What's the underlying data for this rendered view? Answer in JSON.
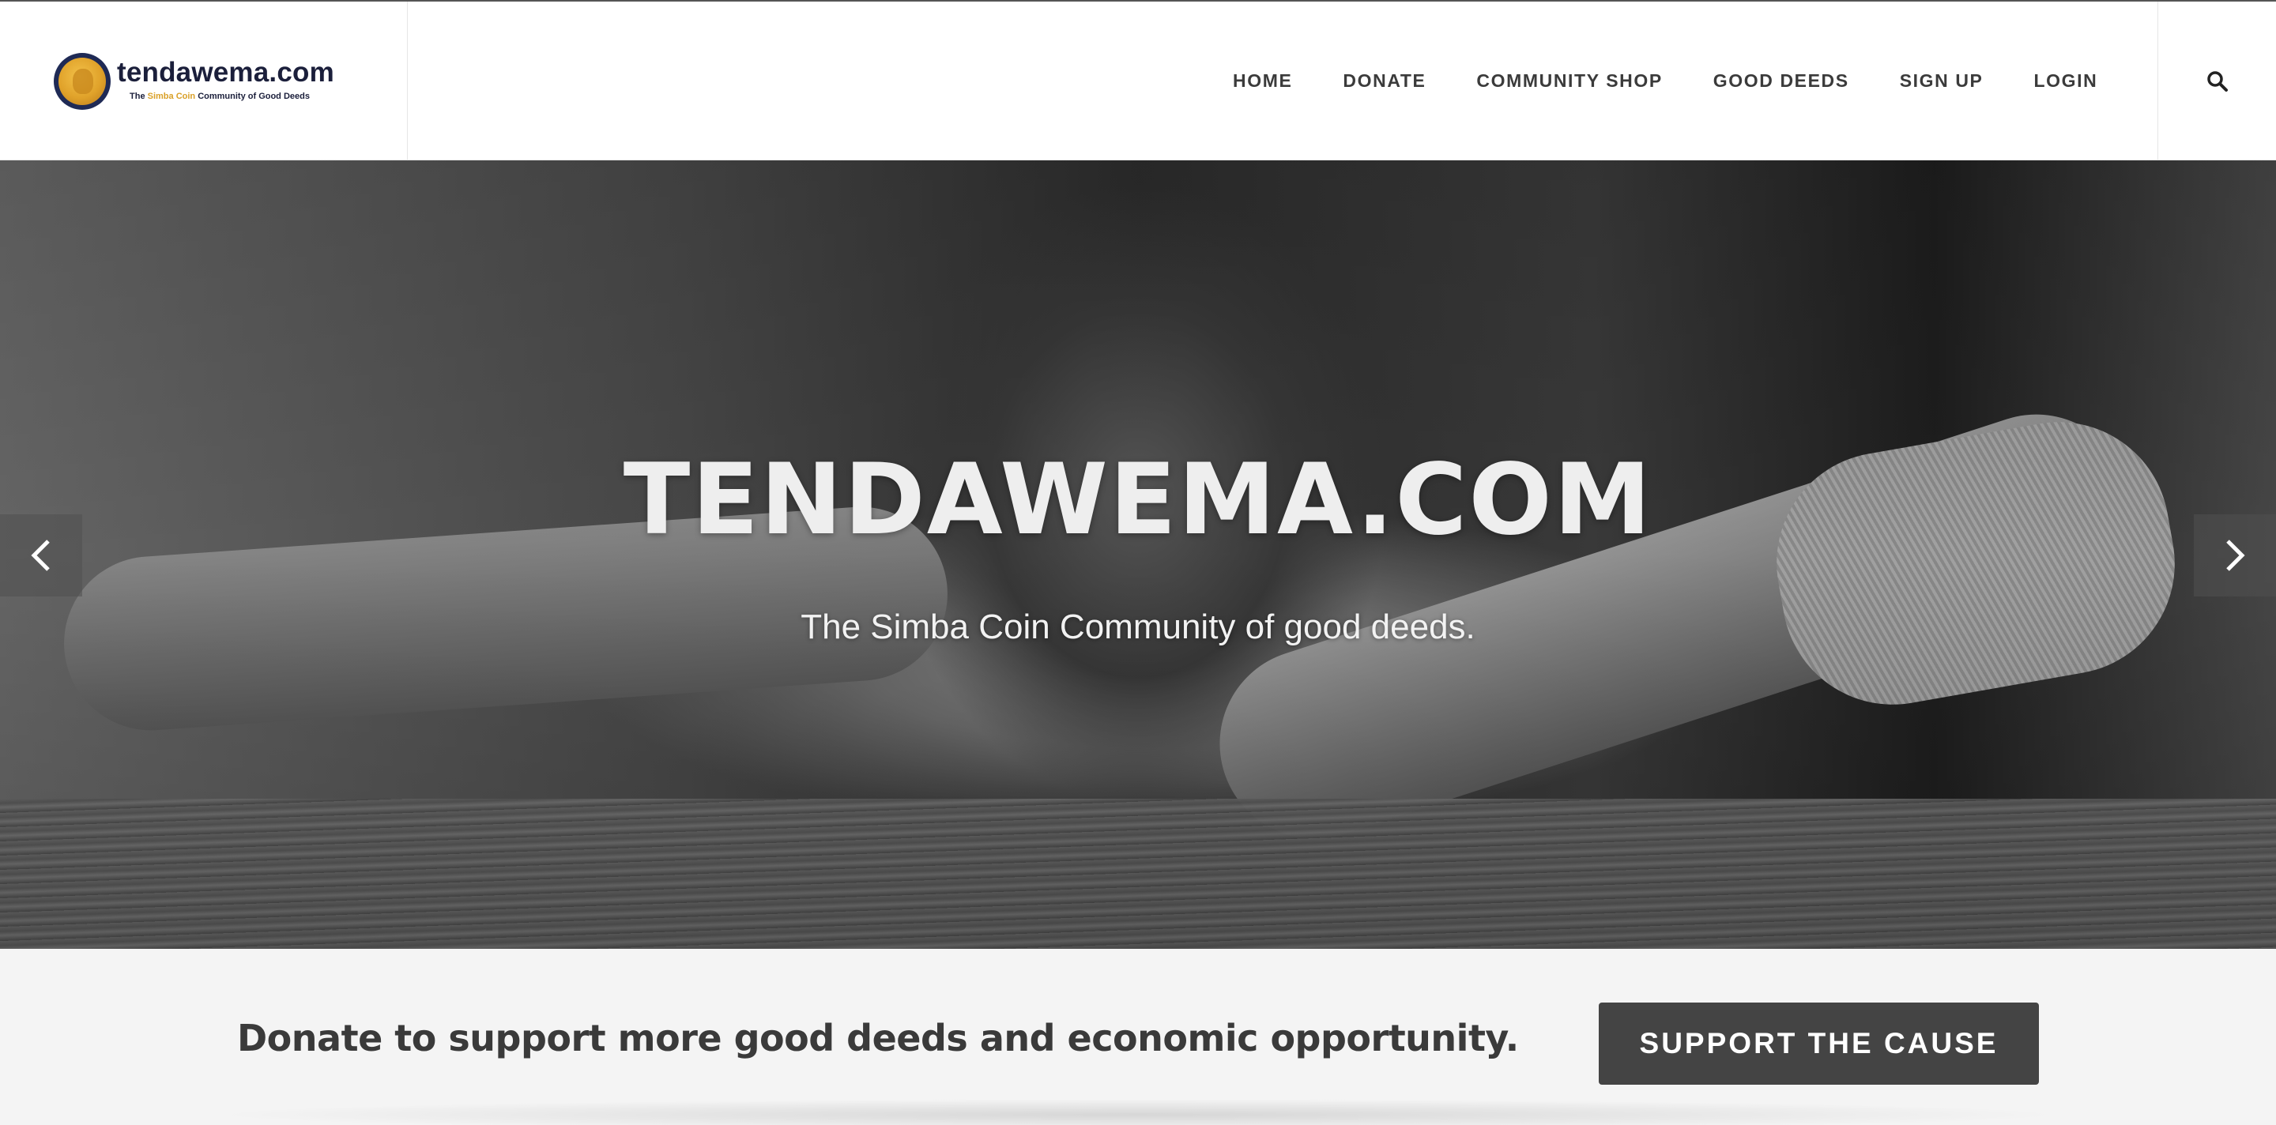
{
  "header": {
    "logo": {
      "title": "tendawema.com",
      "tagline_prefix": "The ",
      "tagline_highlight": "Simba Coin",
      "tagline_suffix": " Community of Good Deeds",
      "icon": "lion-logo-icon"
    },
    "nav": [
      {
        "label": "HOME"
      },
      {
        "label": "DONATE"
      },
      {
        "label": "COMMUNITY SHOP"
      },
      {
        "label": "GOOD DEEDS"
      },
      {
        "label": "SIGN UP"
      },
      {
        "label": "LOGIN"
      }
    ],
    "search_icon": "search-icon"
  },
  "hero": {
    "title": "TENDAWEMA.COM",
    "subtitle": "The Simba Coin Community of good deeds.",
    "prev_icon": "chevron-left-icon",
    "next_icon": "chevron-right-icon"
  },
  "cta": {
    "text": "Donate to support more good deeds and economic opportunity.",
    "button_label": "SUPPORT THE CAUSE"
  },
  "colors": {
    "nav_text": "#3b3b3b",
    "logo_navy": "#1b1f3b",
    "logo_gold": "#d9a028",
    "button_bg": "#444444",
    "cta_band_bg": "#f4f4f4"
  }
}
